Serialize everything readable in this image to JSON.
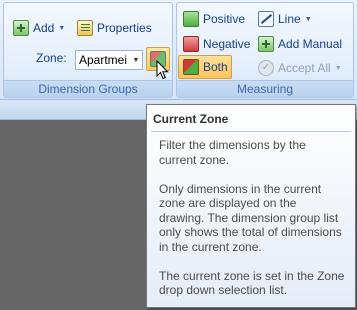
{
  "ribbon": {
    "dimension_groups": {
      "add_label": "Add",
      "properties_label": "Properties",
      "zone_label": "Zone:",
      "zone_value": "Apartmei",
      "caption": "Dimension Groups"
    },
    "measuring": {
      "positive_label": "Positive",
      "negative_label": "Negative",
      "both_label": "Both",
      "line_label": "Line",
      "add_manual_label": "Add Manual",
      "accept_all_label": "Accept All",
      "caption": "Measuring"
    }
  },
  "tooltip": {
    "title": "Current Zone",
    "paragraph_1": "Filter the dimensions by the current zone.",
    "paragraph_2": "Only dimensions in the current zone are displayed on the drawing. The dimension group list only shows the total of dimensions in the current zone.",
    "paragraph_3": "The current zone is set in the Zone drop down selection list."
  },
  "colors": {
    "workspace": "#666666",
    "ribbon_text": "#15428b",
    "highlight": "#ffc95a"
  }
}
